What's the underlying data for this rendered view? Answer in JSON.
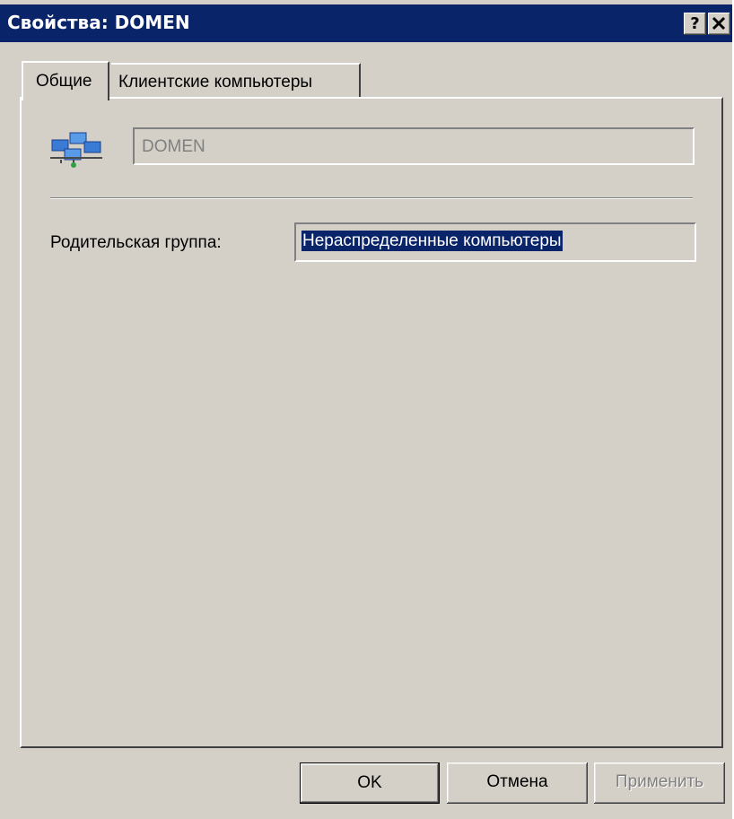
{
  "window": {
    "title": "Свойства: DOMEN",
    "help_label": "?",
    "close_label": "✕"
  },
  "tabs": [
    {
      "label": "Общие",
      "active": true
    },
    {
      "label": "Клиентские компьютеры",
      "active": false
    }
  ],
  "general": {
    "icon": "network-group-icon",
    "name_value": "DOMEN",
    "parent_group_label": "Родительская группа:",
    "parent_group_value": "Нераспределенные компьютеры"
  },
  "buttons": {
    "ok": "OK",
    "cancel": "Отмена",
    "apply": "Применить"
  },
  "colors": {
    "titlebar": "#0a246a",
    "face": "#d4d0c8",
    "selection": "#0a246a"
  }
}
